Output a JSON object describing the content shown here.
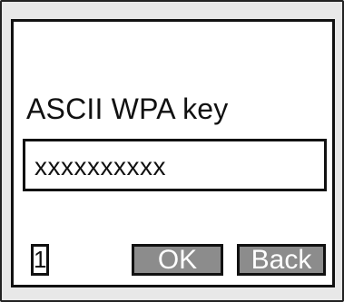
{
  "screen": {
    "prompt_label": "ASCII WPA key",
    "key_field": {
      "value": "xxxxxxxxxx"
    },
    "page_indicator": "1",
    "softkeys": {
      "ok_label": "OK",
      "back_label": "Back"
    }
  },
  "colors": {
    "softkey_background": "#8c8c8c",
    "softkey_text": "#ffffff",
    "frame_background": "#e8e8e8",
    "screen_background": "#ffffff"
  }
}
